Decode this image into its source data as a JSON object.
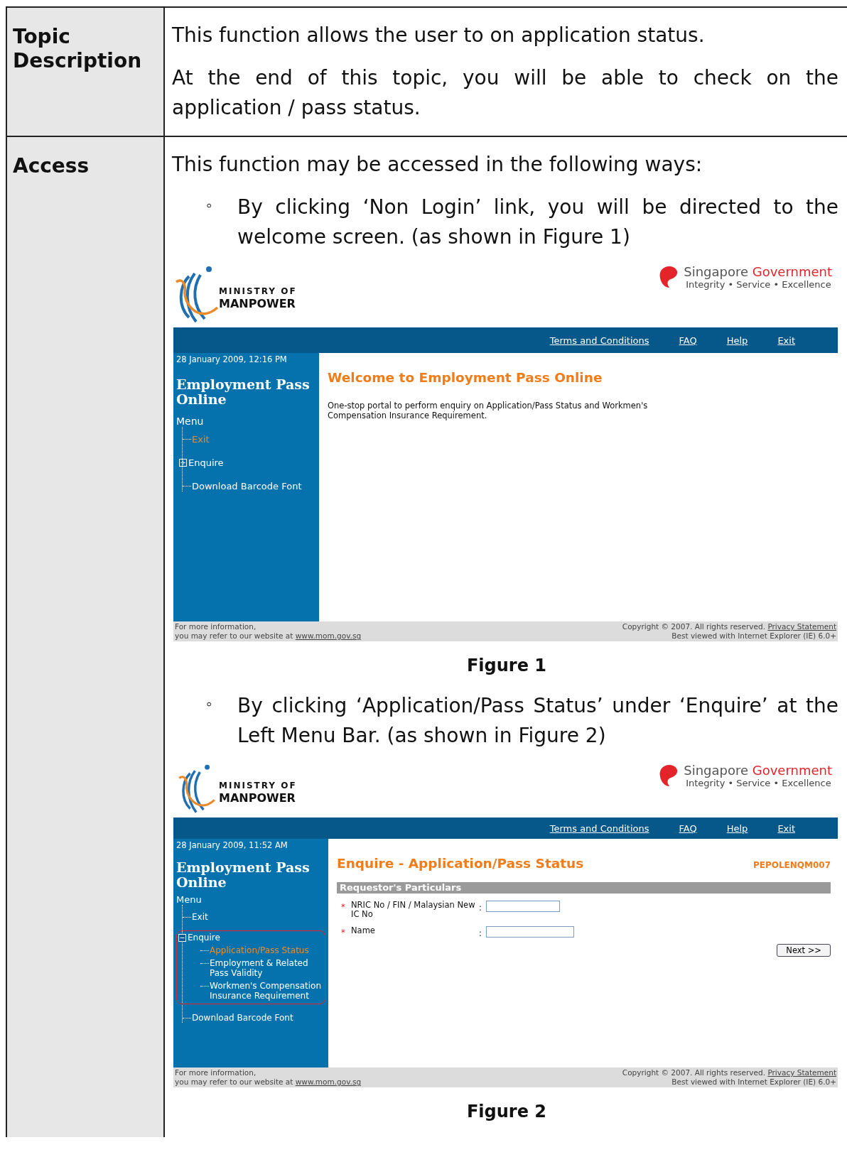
{
  "rows": [
    {
      "heading": "Topic Description",
      "paragraphs": [
        "This function allows the user to on application status.",
        "At the end of this topic, you will be able to check on the application / pass status."
      ]
    },
    {
      "heading": "Access",
      "paragraphs": [
        "This function may be accessed in the following ways:"
      ],
      "items": [
        {
          "marker": "◦",
          "text": "By clicking ‘Non Login’ link, you will be directed to the welcome screen. (as shown in Figure 1)",
          "caption": "Figure 1",
          "screen": {
            "kind": "welcome",
            "logo": [
              "MINISTRY OF",
              "MANPOWER"
            ],
            "gov": {
              "name": "Singapore",
              "name_accent": "Government",
              "motto": "Integrity • Service • Excellence"
            },
            "nav_links": [
              "Terms and Conditions",
              "FAQ",
              "Help",
              "Exit"
            ],
            "date": "28 January 2009, 12:16 PM",
            "app_title": "Employment Pass Online",
            "menu_label": "Menu",
            "menu": [
              {
                "label": "Exit",
                "selected": true
              },
              {
                "label": "Enquire",
                "selected": false,
                "expanded": false,
                "highlighted": false
              },
              {
                "label": "Download Barcode Font",
                "selected": false
              }
            ],
            "title": "Welcome to Employment Pass Online",
            "description": "One-stop portal to perform enquiry on Application/Pass Status and Workmen's Compensation Insurance Requirement.",
            "footer": {
              "info": "For more information,",
              "refer": "you may refer to our website at",
              "site": "www.mom.gov.sg",
              "copyright": "Copyright © 2007. All rights reserved.",
              "privacy": "Privacy Statement",
              "browser": "Best viewed with Internet Explorer (IE) 6.0+"
            }
          }
        },
        {
          "marker": "◦",
          "text": "By clicking ‘Application/Pass Status’ under ‘Enquire’ at the Left Menu Bar. (as shown in Figure 2)",
          "caption": "Figure 2",
          "screen": {
            "kind": "enquiry",
            "logo": [
              "MINISTRY OF",
              "MANPOWER"
            ],
            "gov": {
              "name": "Singapore",
              "name_accent": "Government",
              "motto": "Integrity • Service • Excellence"
            },
            "nav_links": [
              "Terms and Conditions",
              "FAQ",
              "Help",
              "Exit"
            ],
            "date": "28 January 2009, 11:52 AM",
            "app_title": "Employment Pass Online",
            "menu_label": "Menu",
            "menu": [
              {
                "label": "Exit",
                "selected": false
              },
              {
                "label": "Enquire",
                "selected": false,
                "expanded": true,
                "highlighted": true,
                "children": [
                  {
                    "label": "Application/Pass Status",
                    "selected": true
                  },
                  {
                    "label": "Employment & Related Pass Validity",
                    "selected": false
                  },
                  {
                    "label": "Workmen's Compensation Insurance Requirement",
                    "selected": false
                  }
                ]
              },
              {
                "label": "Download Barcode Font",
                "selected": false
              }
            ],
            "title": "Enquire - Application/Pass Status",
            "code": "PEPOLENQM007",
            "section": "Requestor's Particulars",
            "fields": [
              {
                "marker": "*",
                "label": "NRIC No / FIN / Malaysian New IC No",
                "colon": ":"
              },
              {
                "marker": "*",
                "label": "Name",
                "colon": ":"
              }
            ],
            "button": "Next >>",
            "footer": {
              "info": "For more information,",
              "refer": "you may refer to our website at",
              "site": "www.mom.gov.sg",
              "copyright": "Copyright © 2007. All rights reserved.",
              "privacy": "Privacy Statement",
              "browser": "Best viewed with Internet Explorer (IE) 6.0+"
            }
          }
        }
      ]
    }
  ]
}
